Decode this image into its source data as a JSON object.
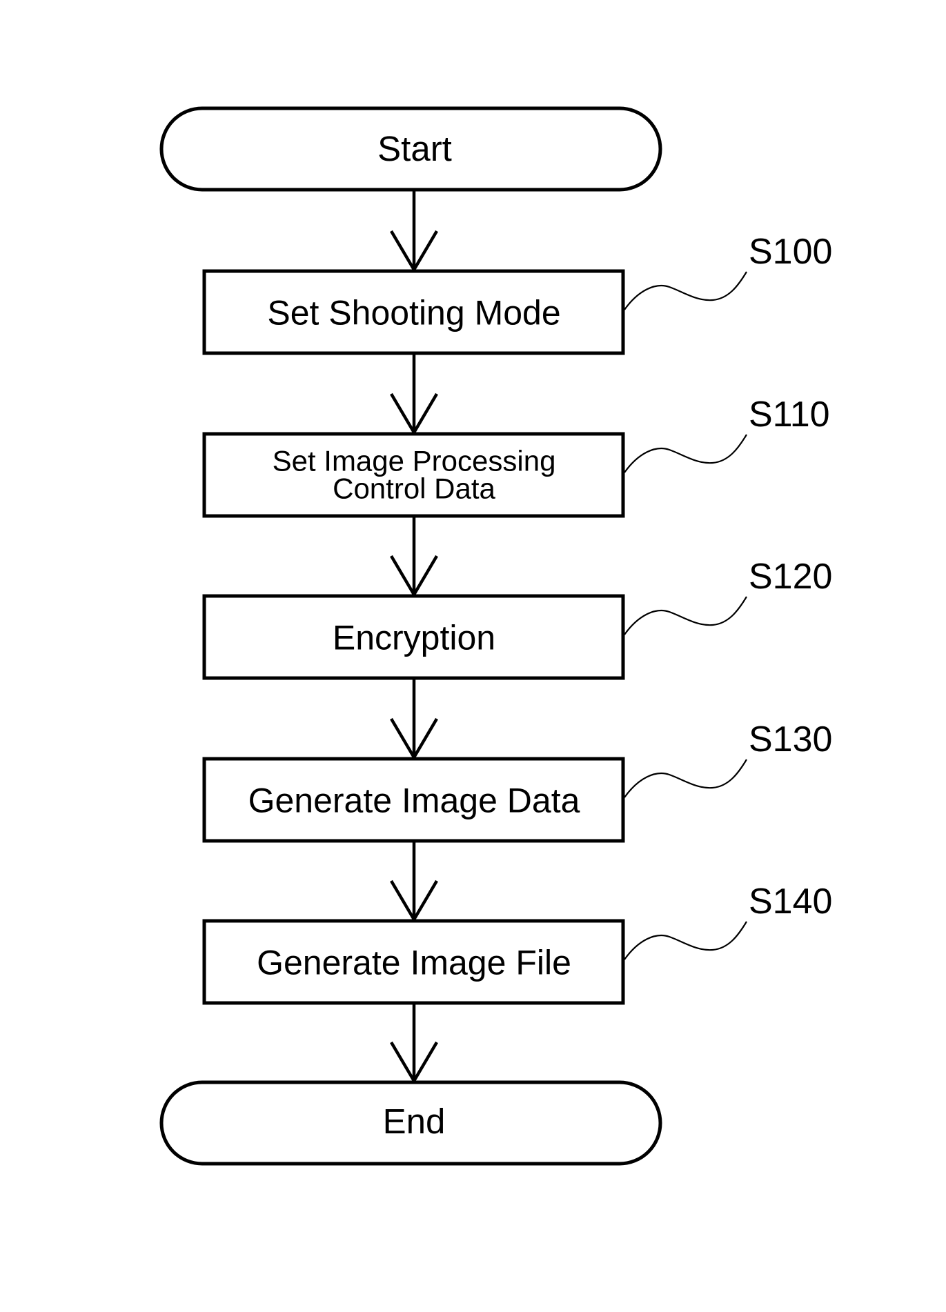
{
  "diagram": {
    "type": "flowchart",
    "terminals": {
      "start": {
        "label": "Start"
      },
      "end": {
        "label": "End"
      }
    },
    "steps": [
      {
        "id": "S100",
        "lines": [
          "Set Shooting Mode"
        ]
      },
      {
        "id": "S110",
        "lines": [
          "Set Image Processing",
          "Control Data"
        ]
      },
      {
        "id": "S120",
        "lines": [
          "Encryption"
        ]
      },
      {
        "id": "S130",
        "lines": [
          "Generate Image Data"
        ]
      },
      {
        "id": "S140",
        "lines": [
          "Generate Image File"
        ]
      }
    ],
    "colors": {
      "line": "#000000",
      "background": "#ffffff"
    }
  }
}
